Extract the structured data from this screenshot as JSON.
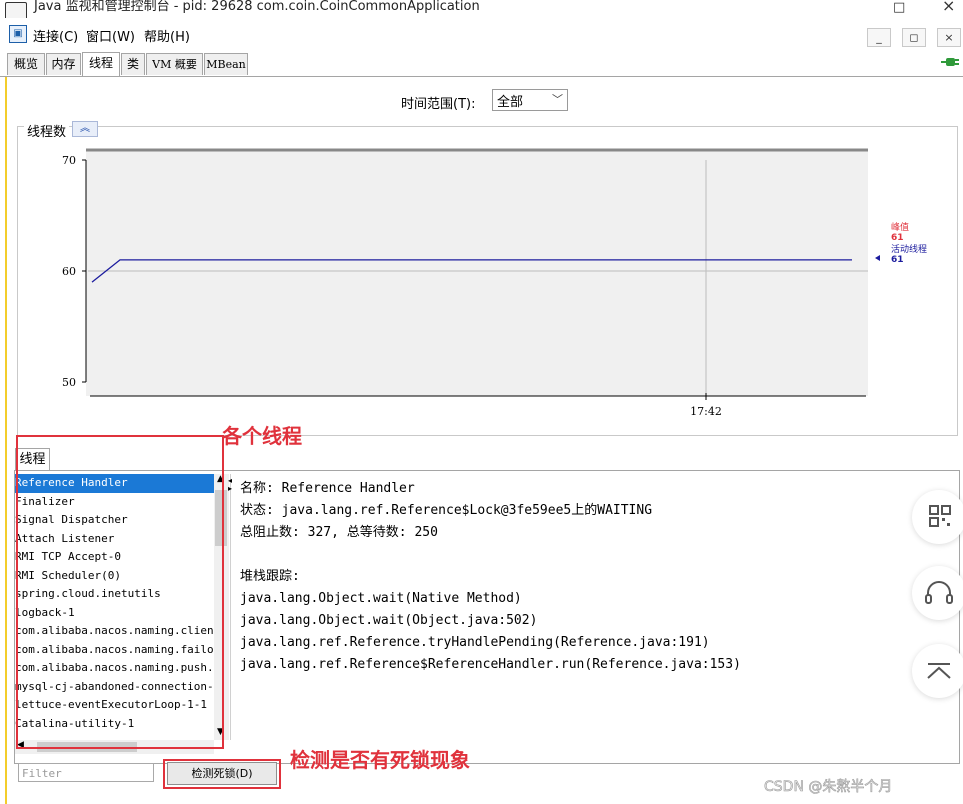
{
  "window": {
    "title": "Java 监视和管理控制台 - pid: 29628 com.coin.CoinCommonApplication",
    "min_glyph": "□",
    "close_glyph": "×"
  },
  "menu": {
    "items": [
      "连接(C)",
      "窗口(W)",
      "帮助(H)"
    ],
    "mdi_buttons": [
      "_",
      "◻",
      "×"
    ]
  },
  "tabs": [
    {
      "label": "概览",
      "active": false
    },
    {
      "label": "内存",
      "active": false
    },
    {
      "label": "线程",
      "active": true
    },
    {
      "label": "类",
      "active": false
    },
    {
      "label": "VM 概要",
      "active": false
    },
    {
      "label": "MBean",
      "active": false
    }
  ],
  "time_range": {
    "label": "时间范围(T):",
    "value": "全部"
  },
  "chart_title": "线程数",
  "chart_data": {
    "type": "line",
    "title": "线程数",
    "ylim": [
      50,
      70
    ],
    "y_ticks": [
      70,
      60,
      50
    ],
    "x_tick_label": "17:42",
    "series": [
      {
        "name": "活动线程",
        "color": "#1c1c9e",
        "points": [
          [
            0,
            59
          ],
          [
            1,
            61
          ],
          [
            2,
            61
          ],
          [
            3,
            61
          ],
          [
            4,
            61
          ],
          [
            5,
            61
          ],
          [
            6,
            61
          ]
        ]
      }
    ],
    "legend": [
      {
        "label": "峰值",
        "value": "61",
        "color": "#e0323c"
      },
      {
        "label": "活动线程",
        "value": "61",
        "color": "#1c1c9e"
      }
    ]
  },
  "threads_tab_label": "线程",
  "thread_list": [
    "Reference Handler",
    "Finalizer",
    "Signal Dispatcher",
    "Attach Listener",
    "RMI TCP Accept-0",
    "RMI Scheduler(0)",
    "spring.cloud.inetutils",
    "logback-1",
    "com.alibaba.nacos.naming.client",
    "com.alibaba.nacos.naming.failover",
    "com.alibaba.nacos.naming.push.receiver",
    "mysql-cj-abandoned-connection-cleanup",
    "lettuce-eventExecutorLoop-1-1",
    "Catalina-utility-1"
  ],
  "selected_thread_index": 0,
  "detail": {
    "name_line": "名称: Reference Handler",
    "state_line": "状态: java.lang.ref.Reference$Lock@3fe59ee5上的WAITING",
    "counts_line": "总阻止数: 327, 总等待数: 250",
    "stack_title": "堆栈跟踪:",
    "stack": [
      "java.lang.Object.wait(Native Method)",
      "java.lang.Object.wait(Object.java:502)",
      "java.lang.ref.Reference.tryHandlePending(Reference.java:191)",
      "java.lang.ref.Reference$ReferenceHandler.run(Reference.java:153)"
    ]
  },
  "filter_placeholder": "Filter",
  "deadlock_button": "检测死锁(D)",
  "annotations": {
    "threads_note": "各个线程",
    "deadlock_note": "检测是否有死锁现象"
  },
  "watermark": "CSDN @朱熬半个月",
  "accent_colors": {
    "annotation_red": "#e0323c",
    "selection_blue": "#1b79d6",
    "series_blue": "#1c1c9e"
  }
}
